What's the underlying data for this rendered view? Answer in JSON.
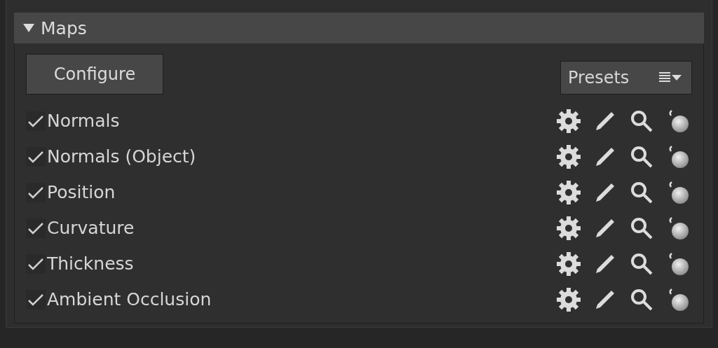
{
  "section": {
    "title": "Maps",
    "expanded": true
  },
  "configure_button": "Configure",
  "presets_button": "Presets",
  "maps": [
    {
      "label": "Normals",
      "checked": true
    },
    {
      "label": "Normals (Object)",
      "checked": true
    },
    {
      "label": "Position",
      "checked": true
    },
    {
      "label": "Curvature",
      "checked": true
    },
    {
      "label": "Thickness",
      "checked": true
    },
    {
      "label": "Ambient Occlusion",
      "checked": true
    }
  ]
}
